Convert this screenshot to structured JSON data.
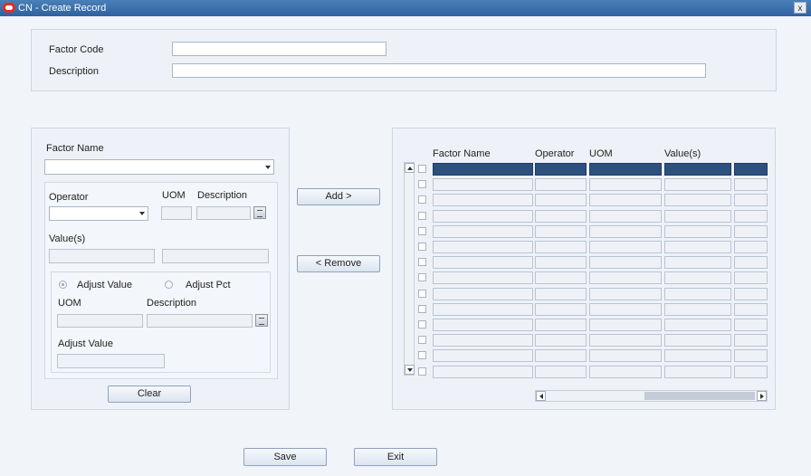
{
  "window": {
    "title": "CN - Create Record",
    "close_label": "x"
  },
  "header": {
    "factor_code_label": "Factor Code",
    "factor_code_value": "",
    "description_label": "Description",
    "description_value": ""
  },
  "left": {
    "factor_name_label": "Factor Name",
    "factor_name_value": "",
    "operator_label": "Operator",
    "uom_label": "UOM",
    "description_label": "Description",
    "values_label": "Value(s)",
    "adjust": {
      "adjust_value_option": "Adjust Value",
      "adjust_pct_option": "Adjust Pct",
      "selected": "Adjust Value",
      "uom_label": "UOM",
      "description_label": "Description",
      "adjust_value_label": "Adjust Value"
    },
    "clear_label": "Clear"
  },
  "middle": {
    "add_label": "Add >",
    "remove_label": "< Remove"
  },
  "grid": {
    "columns": [
      "Factor Name",
      "Operator",
      "UOM",
      "Value(s)"
    ],
    "row_count": 14,
    "selected_row": 0
  },
  "footer": {
    "save_label": "Save",
    "exit_label": "Exit"
  }
}
